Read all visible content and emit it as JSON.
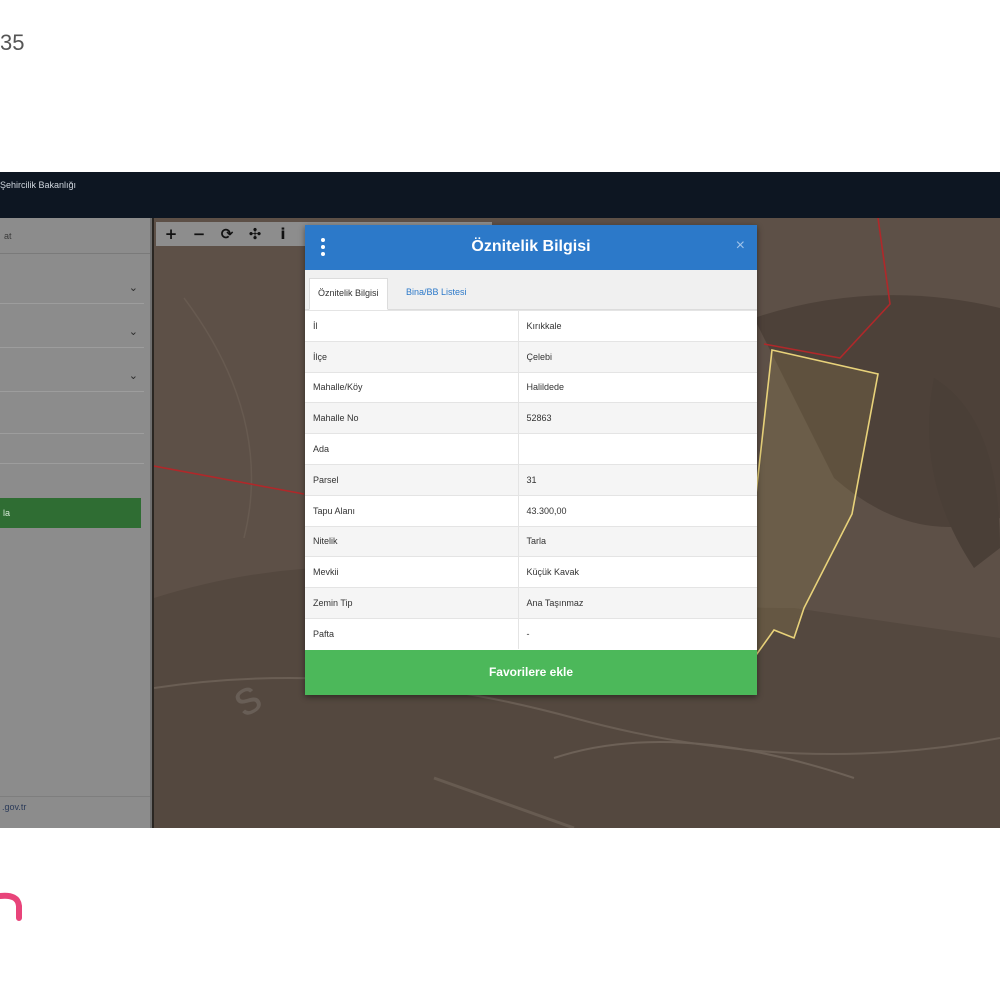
{
  "corner_code": "35",
  "app": {
    "title": "Şehircilik Bakanlığı"
  },
  "sidebar": {
    "header_label": "at",
    "selects": [
      {
        "value": ""
      },
      {
        "value": ""
      },
      {
        "value": ""
      }
    ],
    "query_button_label": "la",
    "footer_link": ".gov.tr"
  },
  "map_toolbar": {
    "tools": [
      {
        "icon": "zoom-in-icon",
        "glyph": "+"
      },
      {
        "icon": "zoom-out-icon",
        "glyph": "−"
      },
      {
        "icon": "refresh-icon",
        "glyph": "⟳"
      },
      {
        "icon": "locate-icon",
        "glyph": "✣"
      },
      {
        "icon": "info-icon",
        "glyph": "i"
      }
    ]
  },
  "dialog": {
    "title": "Öznitelik Bilgisi",
    "close_glyph": "×",
    "tabs": [
      {
        "label": "Öznitelik Bilgisi",
        "active": true
      },
      {
        "label": "Bina/BB Listesi",
        "active": false
      }
    ],
    "rows": [
      {
        "key": "İl",
        "value": "Kırıkkale"
      },
      {
        "key": "İlçe",
        "value": "Çelebi"
      },
      {
        "key": "Mahalle/Köy",
        "value": "Halildede"
      },
      {
        "key": "Mahalle No",
        "value": "52863"
      },
      {
        "key": "Ada",
        "value": ""
      },
      {
        "key": "Parsel",
        "value": "31"
      },
      {
        "key": "Tapu Alanı",
        "value": "43.300,00"
      },
      {
        "key": "Nitelik",
        "value": "Tarla"
      },
      {
        "key": "Mevkii",
        "value": "Küçük Kavak"
      },
      {
        "key": "Zemin Tip",
        "value": "Ana Taşınmaz"
      },
      {
        "key": "Pafta",
        "value": "-"
      }
    ],
    "favorite_button_label": "Favorilere ekle"
  },
  "colors": {
    "dialog_header": "#2c79c9",
    "favorite_button": "#4cb85a",
    "sidebar_button": "#2f6d33",
    "parcel_outline": "#e8d27a",
    "boundary_line": "#b0282a"
  }
}
